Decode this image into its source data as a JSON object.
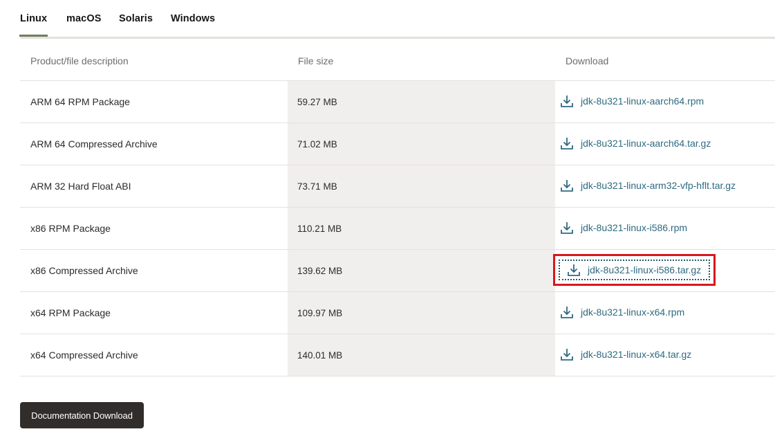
{
  "tabs": [
    {
      "label": "Linux",
      "active": true
    },
    {
      "label": "macOS",
      "active": false
    },
    {
      "label": "Solaris",
      "active": false
    },
    {
      "label": "Windows",
      "active": false
    }
  ],
  "table": {
    "headers": [
      "Product/file description",
      "File size",
      "Download"
    ],
    "rows": [
      {
        "description": "ARM 64 RPM Package",
        "size": "59.27 MB",
        "file": "jdk-8u321-linux-aarch64.rpm"
      },
      {
        "description": "ARM 64 Compressed Archive",
        "size": "71.02 MB",
        "file": "jdk-8u321-linux-aarch64.tar.gz"
      },
      {
        "description": "ARM 32 Hard Float ABI",
        "size": "73.71 MB",
        "file": "jdk-8u321-linux-arm32-vfp-hflt.tar.gz"
      },
      {
        "description": "x86 RPM Package",
        "size": "110.21 MB",
        "file": "jdk-8u321-linux-i586.rpm"
      },
      {
        "description": "x86 Compressed Archive",
        "size": "139.62 MB",
        "file": "jdk-8u321-linux-i586.tar.gz"
      },
      {
        "description": "x64 RPM Package",
        "size": "109.97 MB",
        "file": "jdk-8u321-linux-x64.rpm"
      },
      {
        "description": "x64 Compressed Archive",
        "size": "140.01 MB",
        "file": "jdk-8u321-linux-x64.tar.gz"
      }
    ]
  },
  "doc_button": {
    "label": "Documentation Download"
  },
  "icons": {
    "download": "download-icon"
  },
  "colors": {
    "link": "#2e6a80",
    "active_tab_underline": "#6f7e5b",
    "highlight_box": "#d9161c",
    "button_bg": "#312d2a",
    "size_column_bg": "#f1efed"
  }
}
